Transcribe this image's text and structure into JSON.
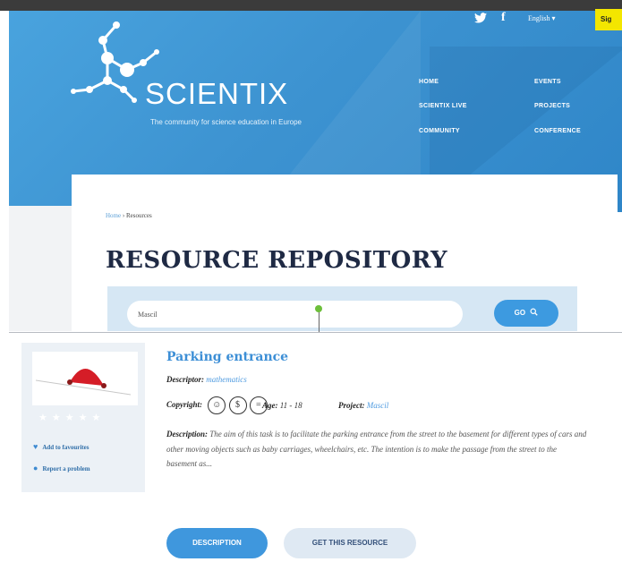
{
  "header": {
    "logo_text": "SCIENTIX",
    "tagline": "The community for science education in Europe",
    "social": {
      "twitter_icon": "twitter-icon",
      "facebook_icon": "facebook-icon",
      "facebook_glyph": "f"
    },
    "language": "English",
    "signin_label": "Sig",
    "nav": {
      "home": "HOME",
      "scientix_live": "SCIENTIX LIVE",
      "community": "COMMUNITY",
      "events": "EVENTS",
      "projects": "PROJECTS",
      "conference": "CONFERENCE"
    }
  },
  "breadcrumb": {
    "home": "Home",
    "separator": " › ",
    "current": "Resources"
  },
  "page_title": "RESOURCE REPOSITORY",
  "search": {
    "value": "Mascil",
    "go_label": "GO"
  },
  "resource": {
    "title": "Parking entrance",
    "descriptor_label": "Descriptor:",
    "descriptor_value": "mathematics",
    "copyright_label": "Copyright:",
    "age_label": "Age:",
    "age_value": "11 - 18",
    "project_label": "Project:",
    "project_value": "Mascil",
    "description_label": "Description:",
    "description_text": "The aim of this task is to facilitate the parking entrance from the street to the basement for different types of cars and other moving objects such as baby carriages, wheelchairs, etc. The intention is to make the passage from the street to the basement as...",
    "rating_stars": "★★★★★",
    "rating_value": 0,
    "add_favourites": "Add to favourites",
    "report_problem": "Report a problem",
    "btn_description": "DESCRIPTION",
    "btn_get": "GET THIS RESOURCE"
  },
  "colors": {
    "header_blue": "#3d93d1",
    "accent_blue": "#3f97dd",
    "title_navy": "#1f2a44",
    "signin_yellow": "#f3e600"
  }
}
